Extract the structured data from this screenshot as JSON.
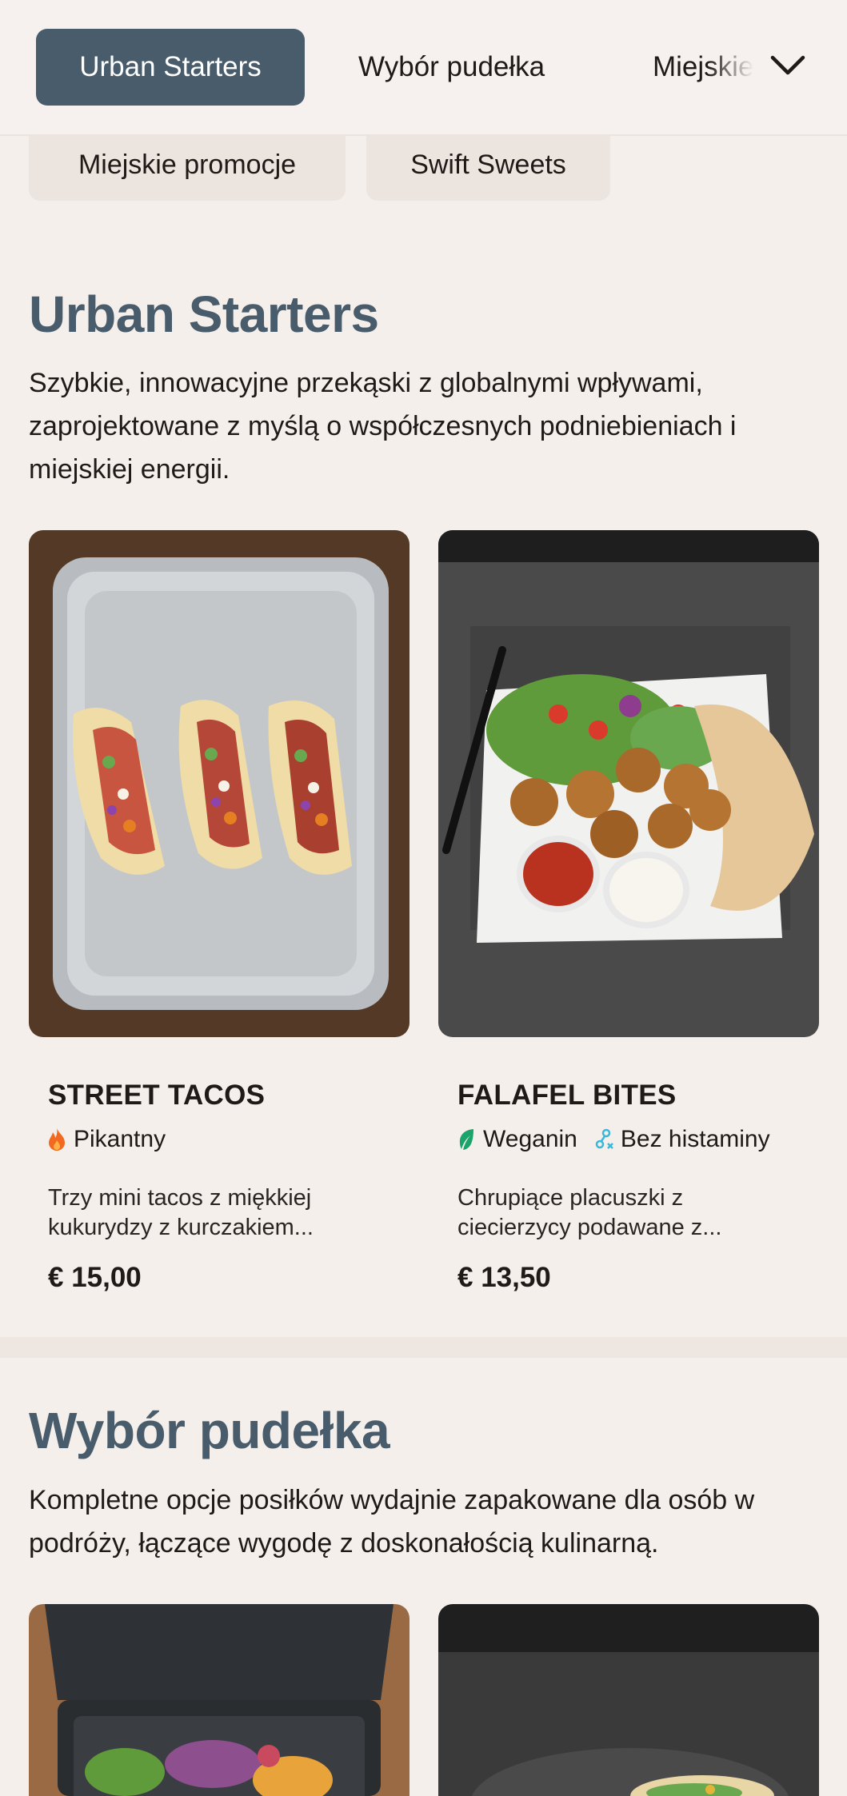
{
  "nav": {
    "tabs": [
      {
        "label": "Urban Starters",
        "active": true
      },
      {
        "label": "Wybór pudełka",
        "active": false
      },
      {
        "label": "Miejskie promocje",
        "active": false
      }
    ],
    "chips": [
      {
        "label": "Miejskie promocje"
      },
      {
        "label": "Swift Sweets"
      }
    ],
    "expand_icon": "chevron-down-icon"
  },
  "sections": [
    {
      "title": "Urban Starters",
      "description": "Szybkie, innowacyjne przekąski z globalnymi wpływami, zaprojektowane z myślą o współczesnych podniebieniach i miejskiej energii.",
      "items": [
        {
          "name": "STREET TACOS",
          "tags": [
            {
              "label": "Pikantny",
              "icon": "flame-icon",
              "color": "#f26a21"
            }
          ],
          "description": "Trzy mini tacos z miękkiej kukurydzy z kurczakiem...",
          "price": "€ 15,00"
        },
        {
          "name": "FALAFEL BITES",
          "tags": [
            {
              "label": "Weganin",
              "icon": "leaf-icon",
              "color": "#1aa36b"
            },
            {
              "label": "Bez histaminy",
              "icon": "histamine-free-icon",
              "color": "#3bb7d9"
            }
          ],
          "description": "Chrupiące placuszki z ciecierzycy podawane z...",
          "price": "€ 13,50"
        }
      ]
    },
    {
      "title": "Wybór pudełka",
      "description": "Kompletne opcje posiłków wydajnie zapakowane dla osób w podróży, łączące wygodę z doskonałością kulinarną."
    }
  ],
  "colors": {
    "accent": "#485c6b",
    "background": "#f5efeb",
    "chip": "#ece4df"
  }
}
